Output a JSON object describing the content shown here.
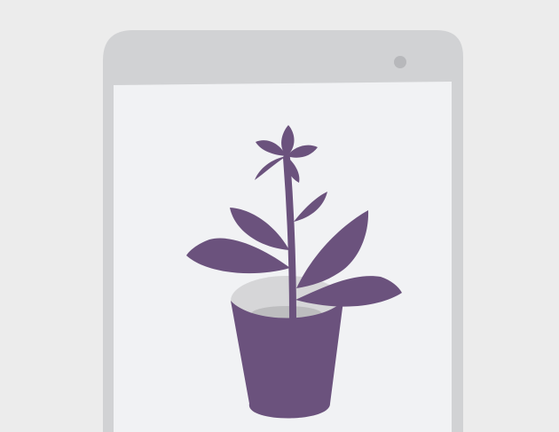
{
  "illustration": {
    "device": "tablet",
    "subject": "potted-plant",
    "icons": [
      "tablet-icon",
      "camera-icon",
      "plant-icon",
      "flower-pot-icon"
    ]
  },
  "colors": {
    "background": "#ececec",
    "device_frame": "#d1d2d4",
    "screen": "#f1f2f4",
    "camera": "#b7b8bb",
    "plant": "#6b527d",
    "pot_rim": "#d6d6d8",
    "soil": "#bdbdbf"
  }
}
